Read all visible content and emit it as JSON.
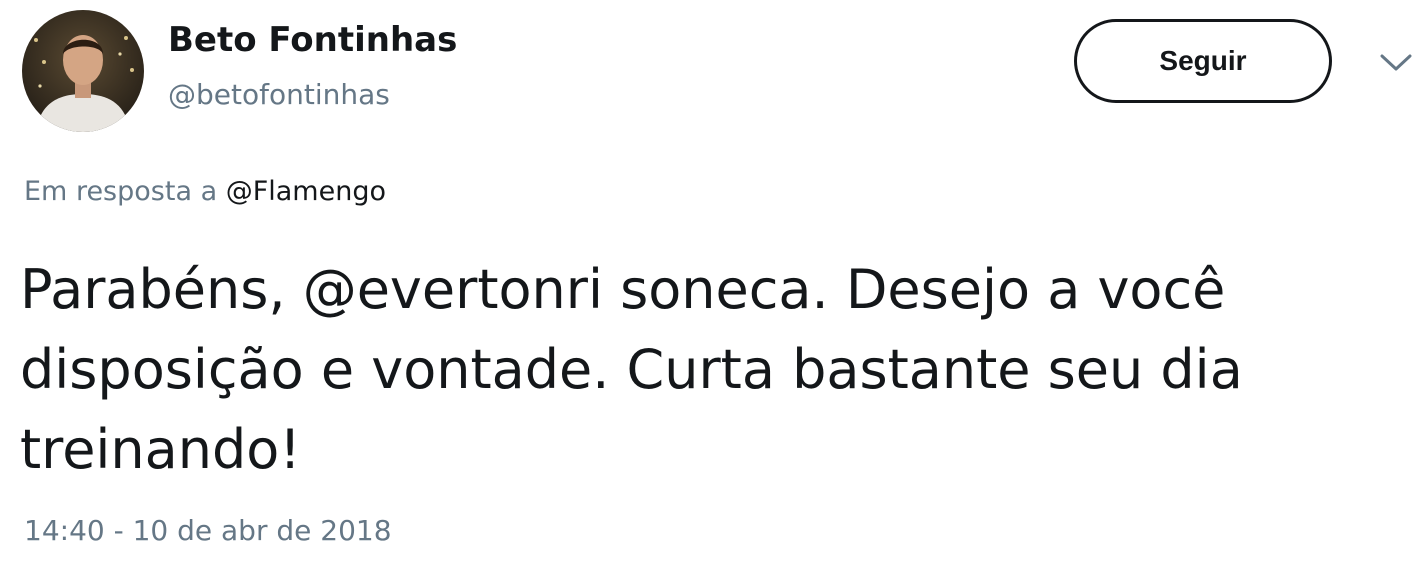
{
  "tweet": {
    "author": {
      "display_name": "Beto Fontinhas",
      "handle": "@betofontinhas"
    },
    "follow_label": "Seguir",
    "more_icon": "chevron-down-icon",
    "reply_context": {
      "prefix": "Em resposta a",
      "mention": "@Flamengo"
    },
    "text_lines": [
      "Parabéns, @evertonri soneca. Desejo a você",
      "disposição e vontade. Curta bastante seu dia",
      "treinando!"
    ],
    "timestamp": "14:40 - 10 de abr de 2018"
  },
  "colors": {
    "text_primary": "#14171a",
    "text_secondary": "#657786",
    "background": "#ffffff"
  }
}
